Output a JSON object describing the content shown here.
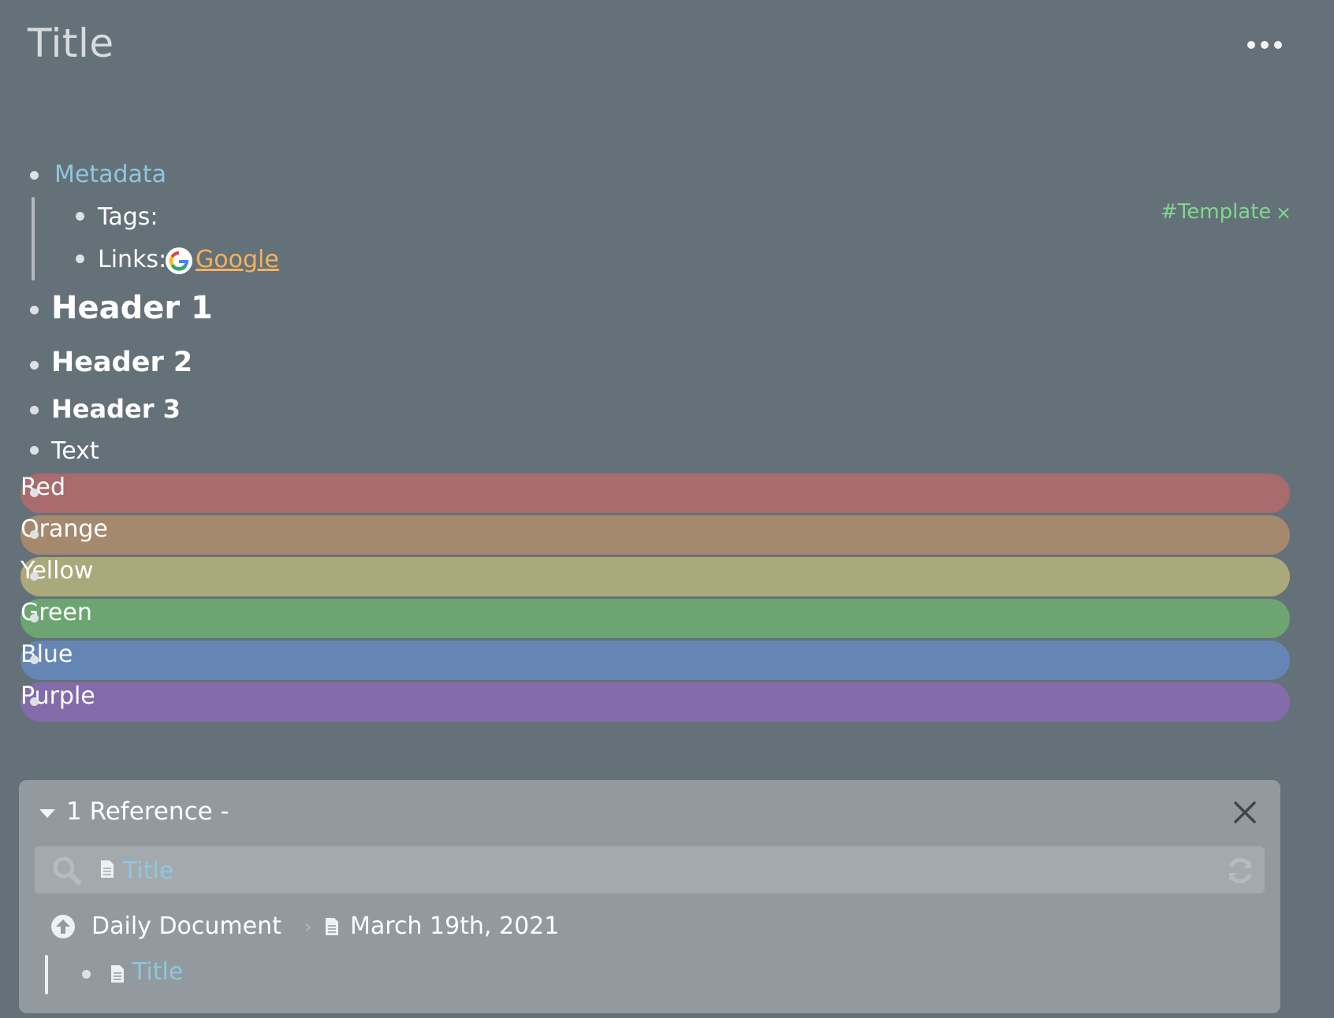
{
  "page": {
    "title": "Title",
    "more_icon": "ellipsis-icon"
  },
  "metadata": {
    "label": "Metadata",
    "tags_label": "Tags:",
    "links_label": "Links:",
    "link_text": " Google",
    "link_icon": "google-icon",
    "tag": "#Template",
    "tag_close": "×"
  },
  "blocks": {
    "header1": "Header 1",
    "header2": "Header 2",
    "header3": "Header 3",
    "text": "Text"
  },
  "color_blocks": [
    {
      "label": "Red",
      "color": "#a96b6e"
    },
    {
      "label": "Orange",
      "color": "#a5896e"
    },
    {
      "label": "Yellow",
      "color": "#aaa97b"
    },
    {
      "label": "Green",
      "color": "#6ca572"
    },
    {
      "label": "Blue",
      "color": "#6586b4"
    },
    {
      "label": "Purple",
      "color": "#846caa"
    }
  ],
  "references": {
    "heading": "1 Reference -",
    "collapse_icon": "caret-down-icon",
    "close_icon": "close-icon",
    "search": {
      "value": "Title",
      "search_icon": "search-icon",
      "doc_icon": "document-icon",
      "refresh_icon": "refresh-icon"
    },
    "breadcrumb": {
      "parent": "Daily Document",
      "separator": "›",
      "page": "March 19th, 2021"
    },
    "item": "Title"
  },
  "colors": {
    "background": "#657178",
    "link_blue": "#8fc6de",
    "link_orange": "#f2b25c",
    "tag_green": "#7fd78e",
    "panel": "#929aa0"
  }
}
